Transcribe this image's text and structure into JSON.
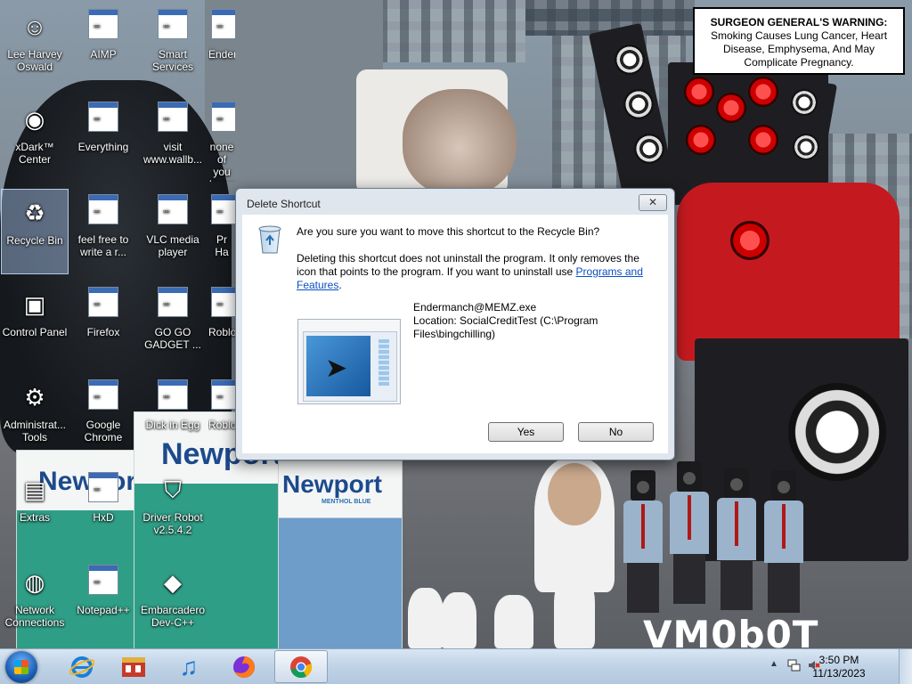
{
  "wallpaper": {
    "warning_title": "SURGEON GENERAL'S WARNING:",
    "warning_body": "Smoking Causes Lung Cancer, Heart Disease, Emphysema, And May Complicate Pregnancy.",
    "pack_brand": "Newport",
    "pack_sub": "MENTHOL BLUE",
    "corner_logo": "VM0b0T"
  },
  "desktop_icons": [
    {
      "label": "Lee Harvey Oswald",
      "icon": "person-icon"
    },
    {
      "label": "AIMP",
      "icon": "app-icon"
    },
    {
      "label": "Smart Services",
      "icon": "app-icon"
    },
    {
      "label": "Enderman...",
      "icon": "app-icon"
    },
    {
      "label": "xDark™ Center",
      "icon": "disc-icon"
    },
    {
      "label": "Everything",
      "icon": "app-icon"
    },
    {
      "label": "visit www.wallb...",
      "icon": "document-icon"
    },
    {
      "label": "none of you know how ...",
      "icon": "app-icon"
    },
    {
      "label": "Recycle Bin",
      "icon": "recycle-bin-icon"
    },
    {
      "label": "feel free to write a r...",
      "icon": "document-icon"
    },
    {
      "label": "VLC media player",
      "icon": "app-icon"
    },
    {
      "label": "Pr Ha",
      "icon": "app-icon"
    },
    {
      "label": "Control Panel",
      "icon": "control-panel-icon"
    },
    {
      "label": "Firefox",
      "icon": "app-icon"
    },
    {
      "label": "GO GO GADGET ...",
      "icon": "app-icon"
    },
    {
      "label": "Roblo",
      "icon": "app-icon"
    },
    {
      "label": "Administrat... Tools",
      "icon": "tools-icon"
    },
    {
      "label": "Google Chrome",
      "icon": "app-icon"
    },
    {
      "label": "Dick in Egg",
      "icon": "app-icon"
    },
    {
      "label": "Roblo",
      "icon": "app-icon"
    },
    {
      "label": "Extras",
      "icon": "folder-icon"
    },
    {
      "label": "HxD",
      "icon": "app-icon"
    },
    {
      "label": "Driver Robot v2.5.4.2",
      "icon": "shield-icon"
    },
    {
      "label": "Network Connections",
      "icon": "network-icon"
    },
    {
      "label": "Notepad++",
      "icon": "app-icon"
    },
    {
      "label": "Embarcadero Dev-C++",
      "icon": "devcpp-icon"
    }
  ],
  "dialog": {
    "title": "Delete Shortcut",
    "close_glyph": "✕",
    "question": "Are you sure you want to move this shortcut to the Recycle Bin?",
    "description": "Deleting this shortcut does not uninstall the program. It only removes the icon that points to the program. If you want to uninstall use",
    "link_text": "Programs and Features",
    "description_end": ".",
    "file_name": "Endermanch@MEMZ.exe",
    "file_location": "Location: SocialCreditTest (C:\\Program Files\\bingchilling)",
    "yes_label": "Yes",
    "no_label": "No"
  },
  "taskbar": {
    "pinned": [
      {
        "name": "internet-explorer-icon"
      },
      {
        "name": "store-icon"
      },
      {
        "name": "music-icon"
      },
      {
        "name": "firefox-icon"
      },
      {
        "name": "chrome-icon",
        "active": true
      }
    ],
    "time": "3:50 PM",
    "date": "11/13/2023"
  }
}
